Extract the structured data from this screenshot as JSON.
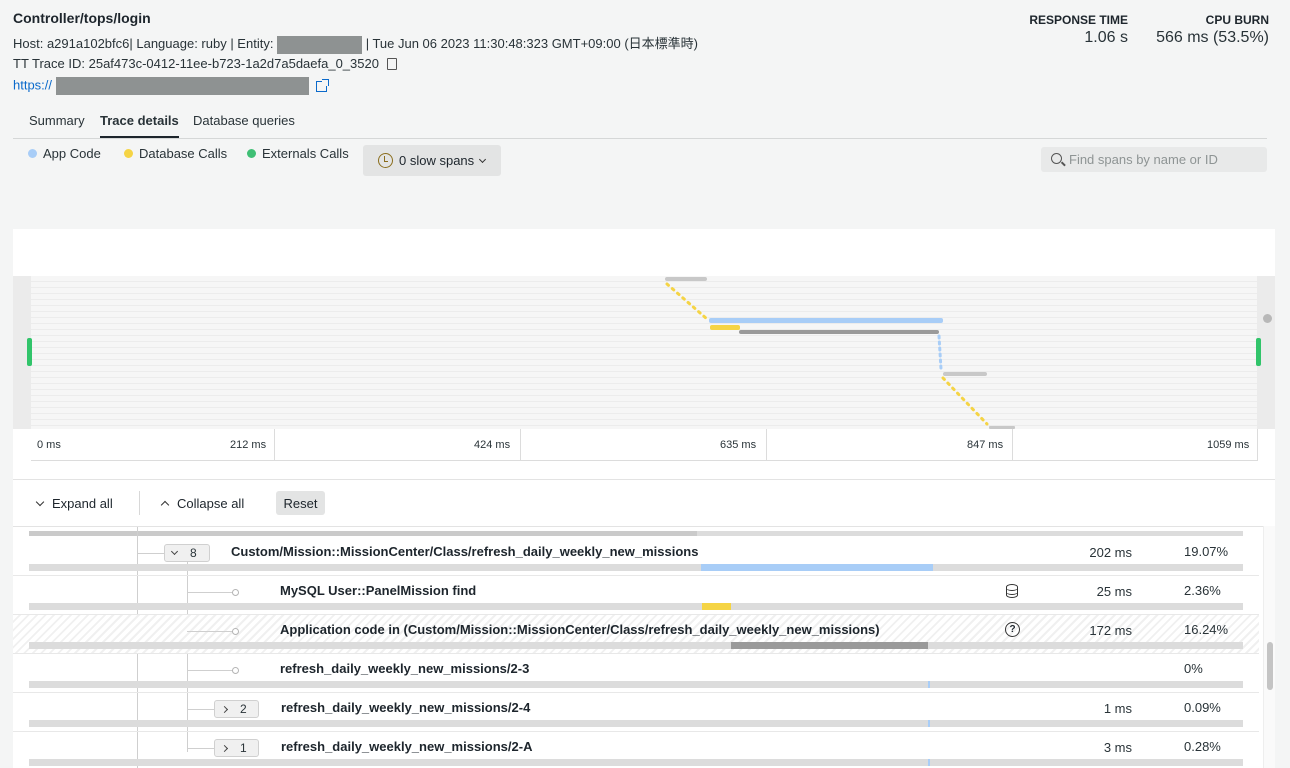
{
  "header": {
    "title": "Controller/tops/login",
    "host_prefix": "Host: a291a102bfc6| Language: ruby | Entity:",
    "host_suffix": "| Tue Jun 06 2023 11:30:48:323 GMT+09:00 (日本標準時)",
    "trace_id": "TT Trace ID: 25af473c-0412-11ee-b723-1a2d7a5daefa_0_3520",
    "url_prefix": "https://"
  },
  "metrics": {
    "response_time_label": "RESPONSE TIME",
    "response_time_value": "1.06 s",
    "cpu_burn_label": "CPU BURN",
    "cpu_burn_value": "566 ms (53.5%)"
  },
  "tabs": [
    {
      "label": "Summary",
      "active": false
    },
    {
      "label": "Trace details",
      "active": true
    },
    {
      "label": "Database queries",
      "active": false
    }
  ],
  "legend": [
    {
      "label": "App Code",
      "color": "#a8cdf7"
    },
    {
      "label": "Database Calls",
      "color": "#f5d445"
    },
    {
      "label": "Externals Calls",
      "color": "#3fbf75"
    }
  ],
  "slow_spans_label": "0 slow spans",
  "search": {
    "placeholder": "Find spans by name or ID"
  },
  "axis_ticks": [
    "0 ms",
    "212 ms",
    "424 ms",
    "635 ms",
    "847 ms",
    "1059 ms"
  ],
  "controls": {
    "expand_all": "Expand all",
    "collapse_all": "Collapse all",
    "reset": "Reset"
  },
  "rows": [
    {
      "name": "Custom/Mission::MissionCenter/Class/refresh_daily_weekly_new_missions",
      "badge": "8",
      "duration": "202 ms",
      "percent": "19.07%",
      "bar_color": "#a8cdf7"
    },
    {
      "name": "MySQL User::PanelMission find",
      "duration": "25 ms",
      "percent": "2.36%",
      "icon": "database-icon",
      "bar_color": "#f5d445"
    },
    {
      "name": "Application code in (Custom/Mission::MissionCenter/Class/refresh_daily_weekly_new_missions)",
      "duration": "172 ms",
      "percent": "16.24%",
      "icon": "question-icon",
      "bar_color": "#9a9a9a"
    },
    {
      "name": "refresh_daily_weekly_new_missions/2-3",
      "duration": "",
      "percent": "0%",
      "bar_color": "#a8cdf7"
    },
    {
      "name": "refresh_daily_weekly_new_missions/2-4",
      "badge": "2",
      "duration": "1 ms",
      "percent": "0.09%",
      "bar_color": "#a8cdf7"
    },
    {
      "name": "refresh_daily_weekly_new_missions/2-A",
      "badge": "1",
      "duration": "3 ms",
      "percent": "0.28%",
      "bar_color": "#a8cdf7"
    }
  ]
}
